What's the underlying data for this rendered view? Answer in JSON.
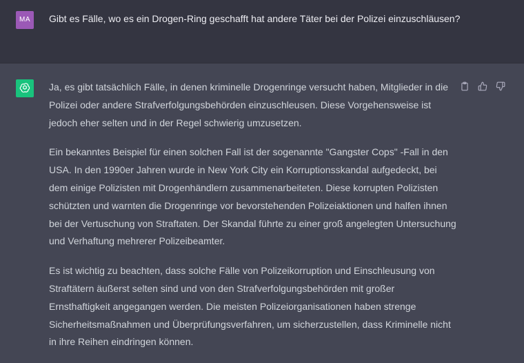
{
  "user_message": {
    "avatar_initials": "MA",
    "avatar_color": "#9b59b6",
    "text": "Gibt es Fälle, wo es ein Drogen-Ring geschafft hat andere Täter bei der Polizei einzuschläusen?"
  },
  "assistant_message": {
    "avatar_icon": "openai-logo-icon",
    "avatar_color": "#19c37d",
    "paragraphs": [
      "Ja, es gibt tatsächlich Fälle, in denen kriminelle Drogenringe versucht haben, Mitglieder in die Polizei oder andere Strafverfolgungsbehörden einzuschleusen. Diese Vorgehensweise ist jedoch eher selten und in der Regel schwierig umzusetzen.",
      "Ein bekanntes Beispiel für einen solchen Fall ist der sogenannte \"Gangster Cops\" -Fall in den USA. In den 1990er Jahren wurde in New York City ein Korruptionsskandal aufgedeckt, bei dem einige Polizisten mit Drogenhändlern zusammenarbeiteten. Diese korrupten Polizisten schützten und warnten die Drogenringe vor bevorstehenden Polizeiaktionen und halfen ihnen bei der Vertuschung von Straftaten. Der Skandal führte zu einer groß angelegten Untersuchung und Verhaftung mehrerer Polizeibeamter.",
      "Es ist wichtig zu beachten, dass solche Fälle von Polizeikorruption und Einschleusung von Straftätern äußerst selten sind und von den Strafverfolgungsbehörden mit großer Ernsthaftigkeit angegangen werden. Die meisten Polizeiorganisationen haben strenge Sicherheitsmaßnahmen und Überprüfungsverfahren, um sicherzustellen, dass Kriminelle nicht in ihre Reihen eindringen können."
    ],
    "actions": [
      {
        "icon": "clipboard-icon"
      },
      {
        "icon": "thumbs-up-icon"
      },
      {
        "icon": "thumbs-down-icon"
      }
    ]
  },
  "colors": {
    "user_bg": "#343541",
    "assistant_bg": "#444654",
    "text_primary": "#ececf1",
    "text_secondary": "#d1d5db",
    "icon": "#acacbe"
  }
}
